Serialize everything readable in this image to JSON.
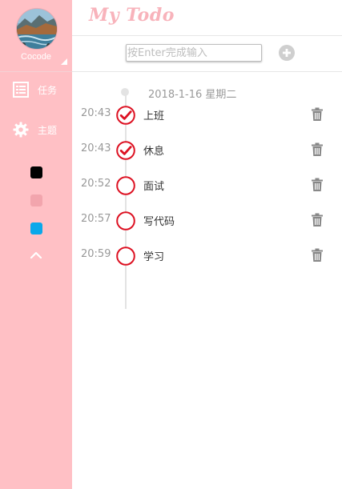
{
  "app": {
    "logo": "My Todo"
  },
  "user": {
    "name": "Cocode"
  },
  "nav": [
    {
      "label": "任务",
      "icon": "list-icon"
    },
    {
      "label": "主题",
      "icon": "gear-icon"
    }
  ],
  "theme_colors": [
    "#000000",
    "#f2a5ad",
    "#0aa8ea"
  ],
  "input": {
    "placeholder": "按Enter完成输入",
    "value": ""
  },
  "date": "2018-1-16 星期二",
  "tasks": [
    {
      "time": "20:43",
      "text": "上班",
      "done": true
    },
    {
      "time": "20:43",
      "text": "休息",
      "done": true
    },
    {
      "time": "20:52",
      "text": "面试",
      "done": false
    },
    {
      "time": "20:57",
      "text": "写代码",
      "done": false
    },
    {
      "time": "20:59",
      "text": "学习",
      "done": false
    }
  ],
  "colors": {
    "sidebar": "#ffc0c5",
    "check": "#dd1122",
    "logo": "#f8b3bb"
  }
}
